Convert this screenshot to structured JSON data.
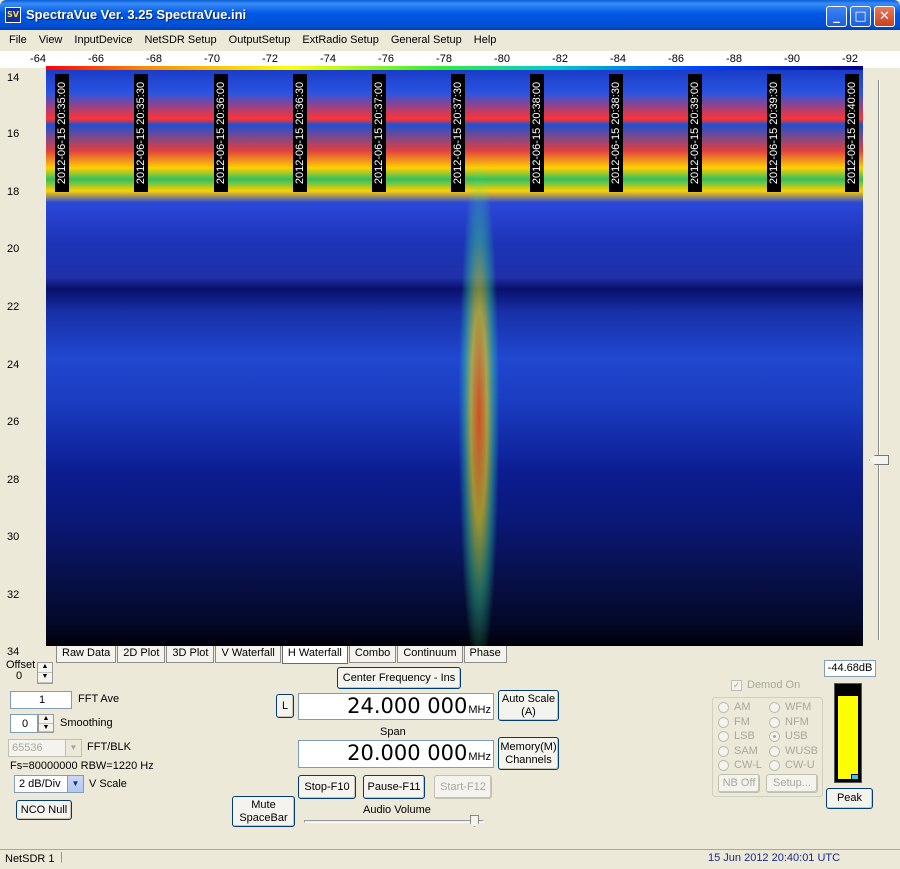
{
  "window": {
    "title": "SpectraVue Ver. 3.25  SpectraVue.ini",
    "icon_text": "SV",
    "controls": {
      "minimize": "_",
      "maximize": "□",
      "close": "✕"
    }
  },
  "menu": [
    "File",
    "View",
    "InputDevice",
    "NetSDR Setup",
    "OutputSetup",
    "ExtRadio Setup",
    "General Setup",
    "Help"
  ],
  "top_axis": {
    "ticks": [
      "-64",
      "-66",
      "-68",
      "-70",
      "-72",
      "-74",
      "-76",
      "-78",
      "-80",
      "-82",
      "-84",
      "-86",
      "-88",
      "-90",
      "-92"
    ]
  },
  "left_axis": {
    "ticks": [
      "14",
      "16",
      "18",
      "20",
      "22",
      "24",
      "26",
      "28",
      "30",
      "32",
      "34"
    ]
  },
  "waterfall": {
    "timestamps": [
      "2012-06-15 20:35:00",
      "2012-06-15 20:35:30",
      "2012-06-15 20:36:00",
      "2012-06-15 20:36:30",
      "2012-06-15 20:37:00",
      "2012-06-15 20:37:30",
      "2012-06-15 20:38:00",
      "2012-06-15 20:38:30",
      "2012-06-15 20:39:00",
      "2012-06-15 20:39:30",
      "2012-06-15 20:40:00"
    ]
  },
  "tabs": [
    {
      "label": "Raw Data",
      "active": false
    },
    {
      "label": "2D Plot",
      "active": false
    },
    {
      "label": "3D Plot",
      "active": false
    },
    {
      "label": "V Waterfall",
      "active": false
    },
    {
      "label": "H Waterfall",
      "active": true
    },
    {
      "label": "Combo",
      "active": false
    },
    {
      "label": "Continuum",
      "active": false
    },
    {
      "label": "Phase",
      "active": false
    }
  ],
  "controls": {
    "offset_label": "Offset",
    "offset_value": "0",
    "fft_ave_value": "1",
    "fft_ave_label": "FFT Ave",
    "smoothing_value": "0",
    "smoothing_label": "Smoothing",
    "fft_blk_value": "65536",
    "fft_blk_label": "FFT/BLK",
    "fs_info": "Fs=80000000 RBW=1220 Hz",
    "vscale_value": "2 dB/Div",
    "vscale_label": "V Scale",
    "nco_null": "NCO Null",
    "center_freq_button": "Center Frequency - Ins",
    "l_button": "L",
    "center_freq_value": "24.000 000",
    "center_freq_unit": "MHz",
    "auto_scale": "Auto Scale\n(A)",
    "span_label": "Span",
    "span_value": "20.000 000",
    "span_unit": "MHz",
    "memory_channels": "Memory(M)\nChannels",
    "stop": "Stop-F10",
    "pause": "Pause-F11",
    "start": "Start-F12",
    "mute": "Mute\nSpaceBar",
    "audio_volume_label": "Audio Volume",
    "audio_volume_level": 0.95
  },
  "demod": {
    "label": "Demod On",
    "checked": true,
    "modes_left": [
      "AM",
      "FM",
      "LSB",
      "SAM",
      "CW-L"
    ],
    "modes_right": [
      "WFM",
      "NFM",
      "USB",
      "WUSB",
      "CW-U"
    ],
    "selected": "USB",
    "nb_off": "NB Off",
    "setup": "Setup..."
  },
  "meter": {
    "value": "-44.68dB",
    "fill_fraction": 0.88,
    "peak_button": "Peak"
  },
  "status": {
    "left": "NetSDR 1",
    "right": "15 Jun 2012  20:40:01 UTC"
  }
}
